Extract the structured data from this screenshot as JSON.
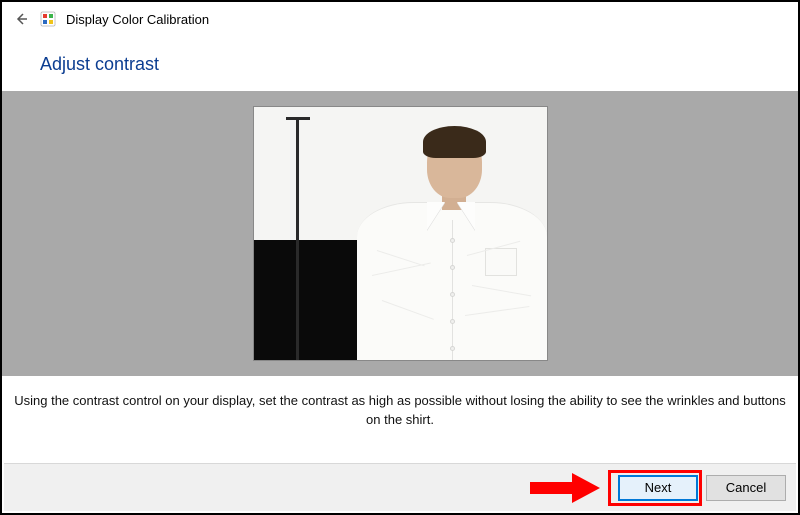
{
  "window": {
    "title": "Display Color Calibration"
  },
  "heading": "Adjust contrast",
  "instruction": "Using the contrast control on your display, set the contrast as high as possible without losing the ability to see the wrinkles and buttons on the shirt.",
  "buttons": {
    "next": "Next",
    "cancel": "Cancel"
  },
  "image_description": "Reference photo of a man wearing a white dress shirt with visible wrinkles and buttons, standing in front of a black and white background with a vertical pole."
}
